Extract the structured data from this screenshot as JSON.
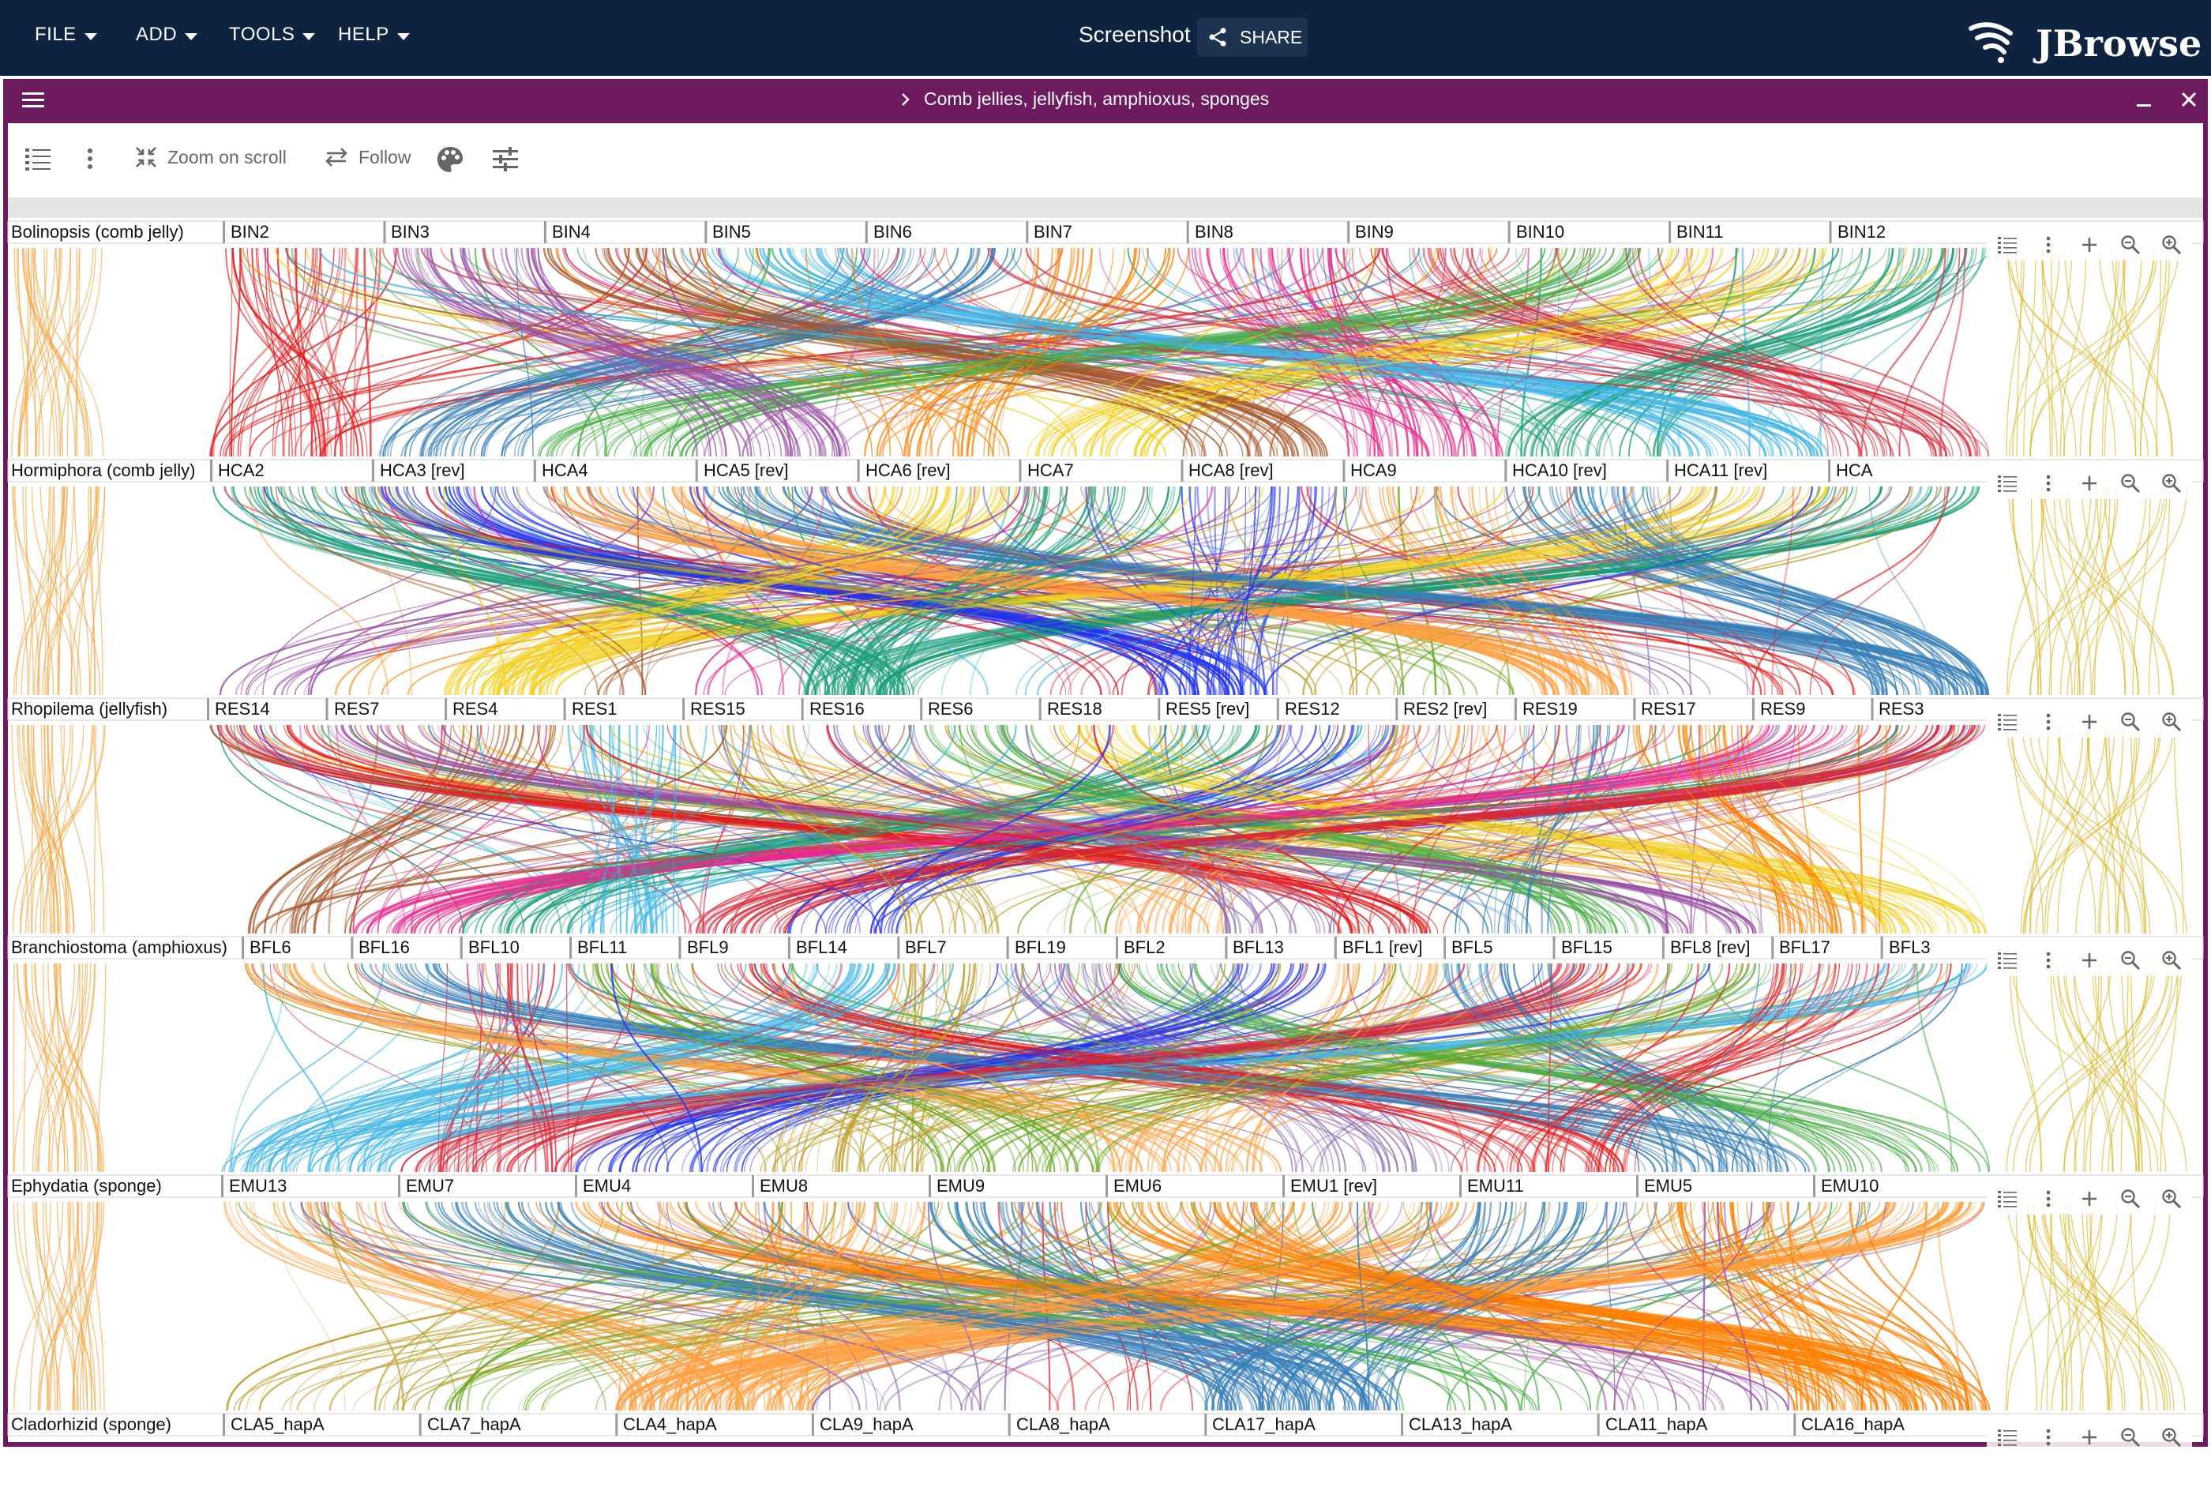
{
  "app": {
    "menus": [
      "FILE",
      "ADD",
      "TOOLS",
      "HELP"
    ],
    "screenshot_label": "Screenshot",
    "share_label": "SHARE",
    "logo_text": "JBrowse",
    "bar_color": "#0e2340"
  },
  "view": {
    "title": "Comb jellies, jellyfish, amphioxus, sponges",
    "frame_color": "#6e1a5e",
    "toolbar": {
      "zoom_on_scroll_label": "Zoom on scroll",
      "follow_label": "Follow"
    }
  },
  "tracks": [
    {
      "name": "Bolinopsis (comb jelly)",
      "chromosomes": [
        "BIN2",
        "BIN3",
        "BIN4",
        "BIN5",
        "BIN6",
        "BIN7",
        "BIN8",
        "BIN9",
        "BIN10",
        "BIN11",
        "BIN12"
      ]
    },
    {
      "name": "Hormiphora (comb jelly)",
      "chromosomes": [
        "HCA2",
        "HCA3 [rev]",
        "HCA4",
        "HCA5 [rev]",
        "HCA6 [rev]",
        "HCA7",
        "HCA8 [rev]",
        "HCA9",
        "HCA10 [rev]",
        "HCA11 [rev]",
        "HCA"
      ]
    },
    {
      "name": "Rhopilema (jellyfish)",
      "chromosomes": [
        "RES14",
        "RES7",
        "RES4",
        "RES1",
        "RES15",
        "RES16",
        "RES6",
        "RES18",
        "RES5 [rev]",
        "RES12",
        "RES2 [rev]",
        "RES19",
        "RES17",
        "RES9",
        "RES3"
      ]
    },
    {
      "name": "Branchiostoma (amphioxus)",
      "chromosomes": [
        "BFL6",
        "BFL16",
        "BFL10",
        "BFL11",
        "BFL9",
        "BFL14",
        "BFL7",
        "BFL19",
        "BFL2",
        "BFL13",
        "BFL1 [rev]",
        "BFL5",
        "BFL15",
        "BFL8 [rev]",
        "BFL17",
        "BFL3"
      ]
    },
    {
      "name": "Ephydatia (sponge)",
      "chromosomes": [
        "EMU13",
        "EMU7",
        "EMU4",
        "EMU8",
        "EMU9",
        "EMU6",
        "EMU1 [rev]",
        "EMU11",
        "EMU5",
        "EMU10"
      ]
    },
    {
      "name": "Cladorhizid (sponge)",
      "chromosomes": [
        "CLA5_hapA",
        "CLA7_hapA",
        "CLA4_hapA",
        "CLA9_hapA",
        "CLA8_hapA",
        "CLA17_hapA",
        "CLA13_hapA",
        "CLA11_hapA",
        "CLA16_hapA"
      ]
    }
  ],
  "synteny_colors": [
    "#e41a1c",
    "#377eb8",
    "#4daf4a",
    "#984ea3",
    "#ff7f00",
    "#f2d024",
    "#a65628",
    "#e7298a",
    "#1b9e77",
    "#41b6e6",
    "#d62839",
    "#2233ee",
    "#c0a030",
    "#66a61e",
    "#ff9f40",
    "#8c6bb1"
  ],
  "icons": [
    "menu-icon",
    "chevron-right-icon",
    "minimize-icon",
    "close-icon",
    "list-icon",
    "more-vert-icon",
    "zoom-on-scroll-icon",
    "swap-icon",
    "palette-icon",
    "tune-icon",
    "plus-icon",
    "zoom-out-icon",
    "zoom-in-icon",
    "share-icon"
  ]
}
